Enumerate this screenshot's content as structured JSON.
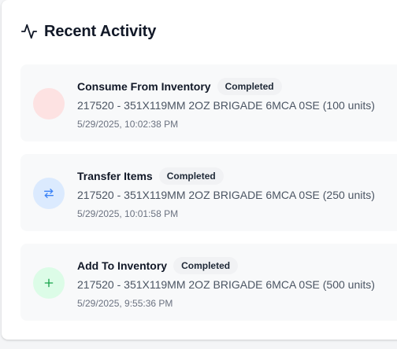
{
  "panel": {
    "title": "Recent Activity",
    "title_icon": "activity-icon"
  },
  "activities": [
    {
      "title": "Consume From Inventory",
      "status": "Completed",
      "description": "217520 - 351X119MM 2OZ BRIGADE 6MCA 0SE (100 units)",
      "timestamp": "5/29/2025, 10:02:38 PM",
      "icon": "consume-icon",
      "icon_bg": "#fde2e2",
      "icon_color": "#ef4444"
    },
    {
      "title": "Transfer Items",
      "status": "Completed",
      "description": "217520 - 351X119MM 2OZ BRIGADE 6MCA 0SE (250 units)",
      "timestamp": "5/29/2025, 10:01:58 PM",
      "icon": "transfer-arrows-icon",
      "icon_bg": "#dbeafe",
      "icon_color": "#3b82f6"
    },
    {
      "title": "Add To Inventory",
      "status": "Completed",
      "description": "217520 - 351X119MM 2OZ BRIGADE 6MCA 0SE (500 units)",
      "timestamp": "5/29/2025, 9:55:36 PM",
      "icon": "plus-icon",
      "icon_bg": "#dcfce7",
      "icon_color": "#16a34a"
    }
  ]
}
